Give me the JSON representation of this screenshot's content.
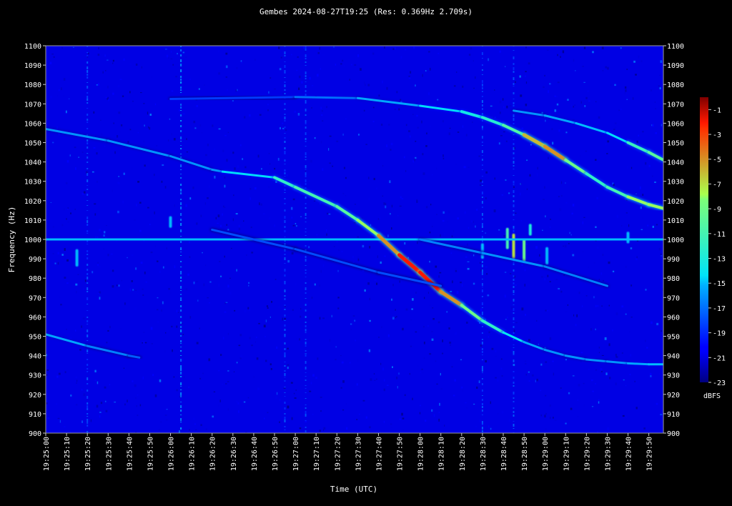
{
  "chart_data": {
    "type": "heatmap",
    "title": "Gembes 2024-08-27T19:25 (Res: 0.369Hz 2.709s)",
    "xlabel": "Time (UTC)",
    "ylabel": "Frequency (Hz)",
    "xlim": [
      "19:25:00",
      "19:29:57"
    ],
    "ylim": [
      900,
      1100
    ],
    "y_ticks": [
      900,
      910,
      920,
      930,
      940,
      950,
      960,
      970,
      980,
      990,
      1000,
      1010,
      1020,
      1030,
      1040,
      1050,
      1060,
      1070,
      1080,
      1090,
      1100
    ],
    "x_ticks": [
      "19:25:00",
      "19:25:10",
      "19:25:20",
      "19:25:30",
      "19:25:40",
      "19:25:50",
      "19:26:00",
      "19:26:10",
      "19:26:20",
      "19:26:30",
      "19:26:40",
      "19:26:50",
      "19:27:00",
      "19:27:10",
      "19:27:20",
      "19:27:30",
      "19:27:40",
      "19:27:50",
      "19:28:00",
      "19:28:10",
      "19:28:20",
      "19:28:30",
      "19:28:40",
      "19:28:50",
      "19:29:00",
      "19:29:10",
      "19:29:20",
      "19:29:30",
      "19:29:40",
      "19:29:50"
    ],
    "colorbar": {
      "label": "dBFS",
      "range": [
        -23,
        0
      ],
      "ticks": [
        -1,
        -3,
        -5,
        -7,
        -9,
        -11,
        -13,
        -15,
        -17,
        -19,
        -21,
        -23
      ]
    },
    "background_level_dbfs": -21,
    "traces": [
      {
        "kind": "carrier",
        "points": [
          [
            "19:25:00",
            1000.0
          ],
          [
            "19:29:57",
            1000.0
          ]
        ],
        "level_dbfs": -15
      },
      {
        "kind": "meteor-echo",
        "points": [
          [
            "19:25:00",
            1057
          ],
          [
            "19:25:30",
            1051
          ],
          [
            "19:26:00",
            1043
          ],
          [
            "19:26:20",
            1036
          ],
          [
            "19:26:25",
            1035
          ],
          [
            "19:26:50",
            1032
          ],
          [
            "19:27:00",
            1027
          ],
          [
            "19:27:20",
            1017
          ],
          [
            "19:27:30",
            1010
          ],
          [
            "19:27:40",
            1002
          ],
          [
            "19:27:50",
            992
          ],
          [
            "19:28:00",
            983
          ],
          [
            "19:28:10",
            973
          ],
          [
            "19:28:20",
            966
          ],
          [
            "19:28:30",
            958
          ],
          [
            "19:28:40",
            952
          ],
          [
            "19:28:50",
            947
          ],
          [
            "19:29:00",
            943
          ],
          [
            "19:29:10",
            940
          ],
          [
            "19:29:20",
            938
          ],
          [
            "19:29:30",
            937
          ],
          [
            "19:29:40",
            936
          ],
          [
            "19:29:50",
            935.5
          ],
          [
            "19:29:57",
            935.5
          ]
        ],
        "levels_dbfs": [
          -16,
          -16,
          -16,
          -16,
          -16,
          -13,
          -11,
          -11,
          -9,
          -7,
          -3,
          -1,
          -3,
          -7,
          -11,
          -13,
          -15,
          -16,
          -16,
          -16,
          -16,
          -16,
          -15,
          -15
        ]
      },
      {
        "kind": "meteor-echo",
        "points": [
          [
            "19:25:00",
            951
          ],
          [
            "19:25:20",
            945
          ],
          [
            "19:25:40",
            940
          ],
          [
            "19:25:45",
            939
          ]
        ],
        "levels_dbfs": [
          -15,
          -16,
          -17,
          -18
        ]
      },
      {
        "kind": "meteor-echo",
        "points": [
          [
            "19:26:00",
            1072.5
          ],
          [
            "19:27:00",
            1073.5
          ],
          [
            "19:27:30",
            1073
          ],
          [
            "19:28:00",
            1069
          ],
          [
            "19:28:20",
            1066
          ],
          [
            "19:28:30",
            1063
          ],
          [
            "19:28:40",
            1059
          ],
          [
            "19:28:50",
            1054
          ],
          [
            "19:29:00",
            1048
          ],
          [
            "19:29:10",
            1041
          ],
          [
            "19:29:20",
            1034
          ],
          [
            "19:29:30",
            1027
          ],
          [
            "19:29:40",
            1022
          ],
          [
            "19:29:50",
            1018
          ],
          [
            "19:29:57",
            1016
          ]
        ],
        "levels_dbfs": [
          -19,
          -18,
          -16,
          -15,
          -14,
          -13,
          -12,
          -9,
          -3,
          -7,
          -11,
          -13,
          -9,
          -7,
          -9
        ]
      },
      {
        "kind": "meteor-echo",
        "points": [
          [
            "19:28:45",
            1066.5
          ],
          [
            "19:29:00",
            1064
          ],
          [
            "19:29:15",
            1060
          ],
          [
            "19:29:30",
            1055
          ],
          [
            "19:29:40",
            1050
          ],
          [
            "19:29:50",
            1045
          ],
          [
            "19:29:57",
            1041
          ]
        ],
        "levels_dbfs": [
          -16,
          -16,
          -15,
          -15,
          -14,
          -9,
          -11
        ]
      },
      {
        "kind": "meteor-echo",
        "points": [
          [
            "19:26:20",
            1005
          ],
          [
            "19:27:00",
            995
          ],
          [
            "19:27:40",
            983
          ],
          [
            "19:28:10",
            976
          ]
        ],
        "levels_dbfs": [
          -18,
          -18,
          -18,
          -18
        ]
      },
      {
        "kind": "meteor-echo",
        "points": [
          [
            "19:28:00",
            1000
          ],
          [
            "19:28:30",
            993
          ],
          [
            "19:29:00",
            986
          ],
          [
            "19:29:30",
            976
          ]
        ],
        "levels_dbfs": [
          -17,
          -16,
          -16,
          -17
        ]
      }
    ],
    "noise_bursts": [
      {
        "time": "19:25:15",
        "freq_range": [
          986,
          995
        ],
        "level_dbfs": -15
      },
      {
        "time": "19:26:00",
        "freq_range": [
          1006,
          1012
        ],
        "level_dbfs": -15
      },
      {
        "time": "19:28:42",
        "freq_range": [
          995,
          1006
        ],
        "level_dbfs": -11
      },
      {
        "time": "19:28:45",
        "freq_range": [
          990,
          1003
        ],
        "level_dbfs": -7
      },
      {
        "time": "19:28:50",
        "freq_range": [
          988,
          1000
        ],
        "level_dbfs": -9
      },
      {
        "time": "19:28:53",
        "freq_range": [
          1002,
          1008
        ],
        "level_dbfs": -13
      },
      {
        "time": "19:29:01",
        "freq_range": [
          987,
          996
        ],
        "level_dbfs": -15
      },
      {
        "time": "19:28:30",
        "freq_range": [
          990,
          998
        ],
        "level_dbfs": -15
      },
      {
        "time": "19:29:40",
        "freq_range": [
          998,
          1004
        ],
        "level_dbfs": -15
      }
    ],
    "vertical_streaks": [
      {
        "time": "19:26:05",
        "level_dbfs": -17
      },
      {
        "time": "19:25:20",
        "level_dbfs": -19
      },
      {
        "time": "19:26:55",
        "level_dbfs": -19
      },
      {
        "time": "19:27:05",
        "level_dbfs": -19
      },
      {
        "time": "19:28:45",
        "level_dbfs": -19
      },
      {
        "time": "19:28:30",
        "level_dbfs": -19
      }
    ]
  }
}
